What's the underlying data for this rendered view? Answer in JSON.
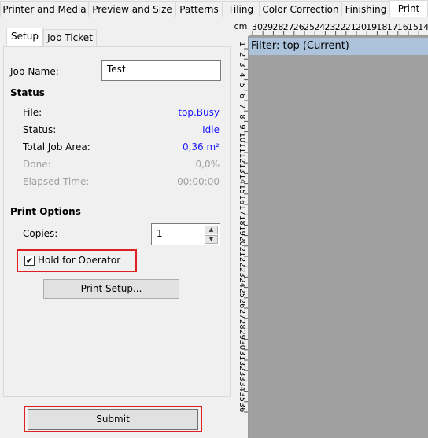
{
  "top_tabs": {
    "items": [
      "Printer and Media",
      "Preview and Size",
      "Patterns",
      "Tiling",
      "Color Correction",
      "Finishing",
      "Print"
    ],
    "active": "Print"
  },
  "inner_tabs": {
    "setup": "Setup",
    "job_ticket": "Job Ticket",
    "active": "Setup"
  },
  "job": {
    "name_label": "Job Name:",
    "name_value": "Test"
  },
  "status": {
    "heading": "Status",
    "file_label": "File:",
    "file_value": "top.Busy",
    "status_label": "Status:",
    "status_value": "Idle",
    "area_label": "Total Job Area:",
    "area_value": "0,36 m²",
    "done_label": "Done:",
    "done_value": "0,0%",
    "elapsed_label": "Elapsed Time:",
    "elapsed_value": "00:00:00"
  },
  "print_options": {
    "heading": "Print Options",
    "copies_label": "Copies:",
    "copies_value": "1",
    "hold_label": "Hold for Operator",
    "hold_checked": true,
    "setup_button": "Print Setup..."
  },
  "submit": {
    "label": "Submit"
  },
  "ruler": {
    "unit": "cm",
    "h_labels": [
      "30",
      "29",
      "28",
      "27",
      "26",
      "25",
      "24",
      "23",
      "22",
      "21",
      "20",
      "19",
      "18",
      "17",
      "16",
      "15",
      "14"
    ],
    "v_labels": [
      "1",
      "2",
      "3",
      "4",
      "5",
      "6",
      "7",
      "8",
      "9",
      "10",
      "11",
      "12",
      "13",
      "14",
      "15",
      "16",
      "17",
      "18",
      "19",
      "20",
      "21",
      "22",
      "23",
      "24",
      "25",
      "26",
      "27",
      "28",
      "29",
      "30",
      "31",
      "32",
      "33",
      "34",
      "35",
      "36"
    ]
  },
  "preview": {
    "filter_label": "Filter: top (Current)"
  },
  "colors": {
    "highlight_outline": "#e02020",
    "blue_value": "#1a1aff",
    "disabled_text": "#a0a0a0",
    "filter_bar": "#adc3dc",
    "preview_bg": "#a0a0a0"
  }
}
